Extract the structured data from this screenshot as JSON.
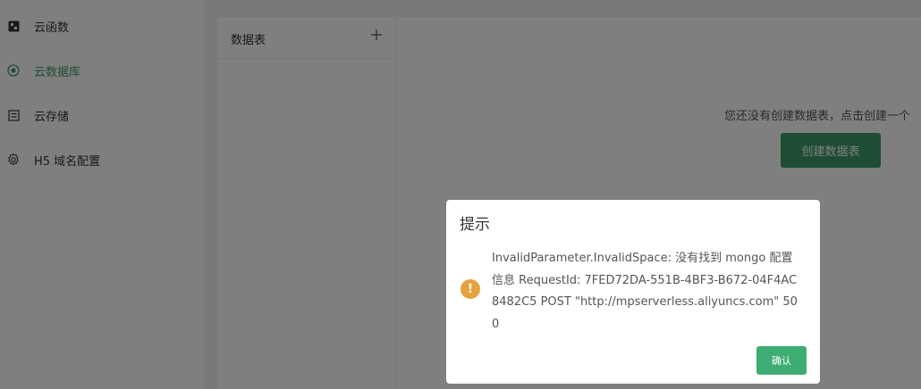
{
  "sidebar": {
    "items": [
      {
        "label": "云函数",
        "icon": "cloud-function-icon",
        "active": false
      },
      {
        "label": "云数据库",
        "icon": "database-icon",
        "active": true
      },
      {
        "label": "云存储",
        "icon": "storage-icon",
        "active": false
      },
      {
        "label": "H5 域名配置",
        "icon": "settings-icon",
        "active": false
      }
    ]
  },
  "table_panel": {
    "title": "数据表",
    "add_icon": "plus-icon"
  },
  "empty_state": {
    "text": "您还没有创建数据表，点击创建一个",
    "create_button": "创建数据表"
  },
  "dialog": {
    "title": "提示",
    "message": "InvalidParameter.InvalidSpace: 没有找到 mongo 配置信息 RequestId: 7FED72DA-551B-4BF3-B672-04F4AC8482C5 POST \"http://mpserverless.aliyuncs.com\" 500",
    "icon": "warning-icon",
    "icon_glyph": "!",
    "confirm": "确认"
  },
  "colors": {
    "accent": "#3d9b68",
    "warning": "#e6a23c",
    "overlay": "rgba(0,0,0,0.5)"
  }
}
